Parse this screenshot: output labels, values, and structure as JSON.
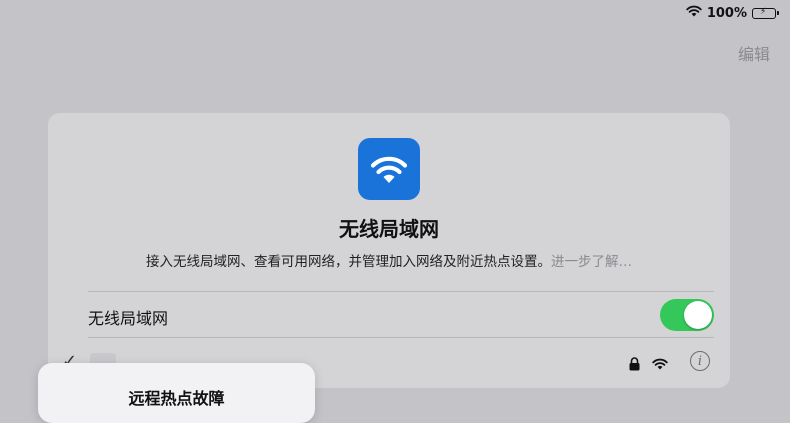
{
  "status_bar": {
    "battery_percent": "100%",
    "wifi_icon": "wifi-icon",
    "battery_level": 1.0
  },
  "header": {
    "edit_label": "编辑"
  },
  "card": {
    "icon": "wifi-icon",
    "title": "无线局域网",
    "description": "接入无线局域网、查看可用网络，并管理加入网络及附近热点设置。",
    "learn_more": "进一步了解…",
    "wifi_toggle_label": "无线局域网",
    "wifi_toggle_on": true,
    "toggle_color": "#34c759"
  },
  "network": {
    "connected": true,
    "icons": [
      "check-icon",
      "lock-icon",
      "wifi-icon",
      "info-icon"
    ]
  },
  "popup": {
    "title": "远程热点故障"
  }
}
